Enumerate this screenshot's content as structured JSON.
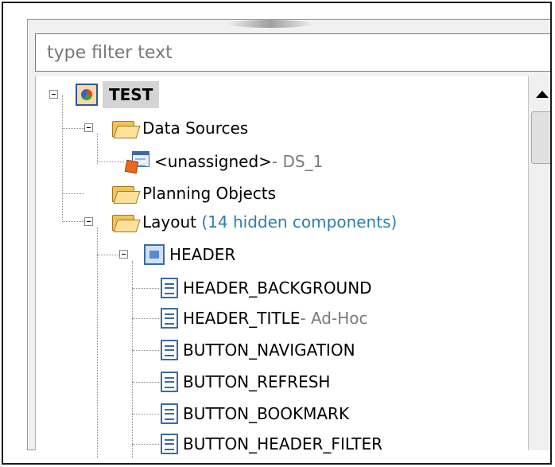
{
  "filter": {
    "placeholder": "type filter text"
  },
  "tree": {
    "root": {
      "label": "TEST",
      "icon": "application-icon"
    },
    "data_sources": {
      "label": "Data Sources",
      "icon": "folder-icon",
      "items": [
        {
          "label": "<unassigned>",
          "suffix": " - DS_1",
          "icon": "datasource-icon"
        }
      ]
    },
    "planning_objects": {
      "label": "Planning Objects",
      "icon": "folder-icon"
    },
    "layout": {
      "label": "Layout",
      "hidden_note": "(14 hidden components)",
      "icon": "folder-icon",
      "header": {
        "label": "HEADER",
        "icon": "component-icon",
        "children": [
          {
            "label": "HEADER_BACKGROUND",
            "suffix": ""
          },
          {
            "label": "HEADER_TITLE",
            "suffix": " - Ad-Hoc"
          },
          {
            "label": "BUTTON_NAVIGATION",
            "suffix": ""
          },
          {
            "label": "BUTTON_REFRESH",
            "suffix": ""
          },
          {
            "label": "BUTTON_BOOKMARK",
            "suffix": ""
          },
          {
            "label": "BUTTON_HEADER_FILTER",
            "suffix": ""
          }
        ]
      }
    }
  }
}
